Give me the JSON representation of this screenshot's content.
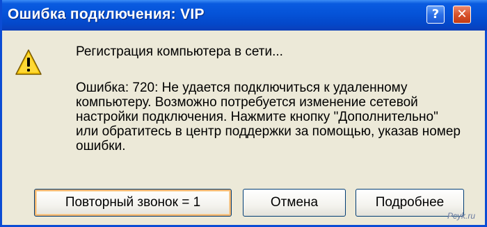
{
  "window": {
    "title": "Ошибка подключения: VIP",
    "help_glyph": "?",
    "close_glyph": "✕"
  },
  "content": {
    "icon": "warning-icon",
    "status": "Регистрация компьютера в сети...",
    "error_lines": [
      "Ошибка: 720: Не удается подключиться к удаленному",
      "компьютеру. Возможно потребуется изменение сетевой",
      "настройки подключения. Нажмите кнопку \"Дополнительно\"",
      "или обратитесь в центр поддержки за помощью, указав номер",
      "ошибки."
    ]
  },
  "buttons": {
    "redial": "Повторный звонок = 1",
    "cancel": "Отмена",
    "more": "Подробнее"
  },
  "watermark": "Pcyk.ru",
  "colors": {
    "title_bar": "#0553d8",
    "dialog_bg": "#ece9d8",
    "close_button": "#d9542c",
    "warning": "#f5c400"
  }
}
